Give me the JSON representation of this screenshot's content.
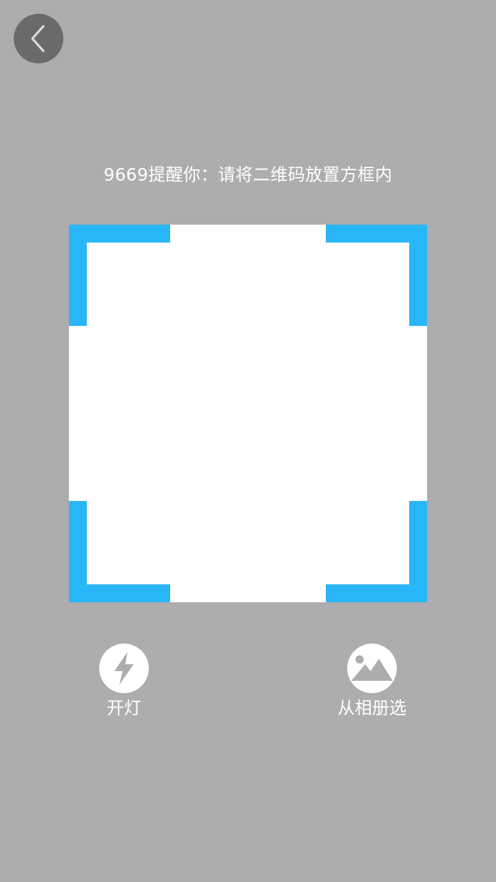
{
  "header": {
    "back_icon": "chevron-left-icon"
  },
  "hint": {
    "text": "9669提醒你：请将二维码放置方框内"
  },
  "scanner": {
    "corner_color": "#29b6f6",
    "frame_color": "#ffffff"
  },
  "actions": {
    "flash": {
      "label": "开灯",
      "icon": "flash-icon"
    },
    "album": {
      "label": "从相册选",
      "icon": "image-icon"
    }
  },
  "colors": {
    "background": "#adadad",
    "back_button": "#6a6a6a",
    "text": "#ffffff"
  }
}
